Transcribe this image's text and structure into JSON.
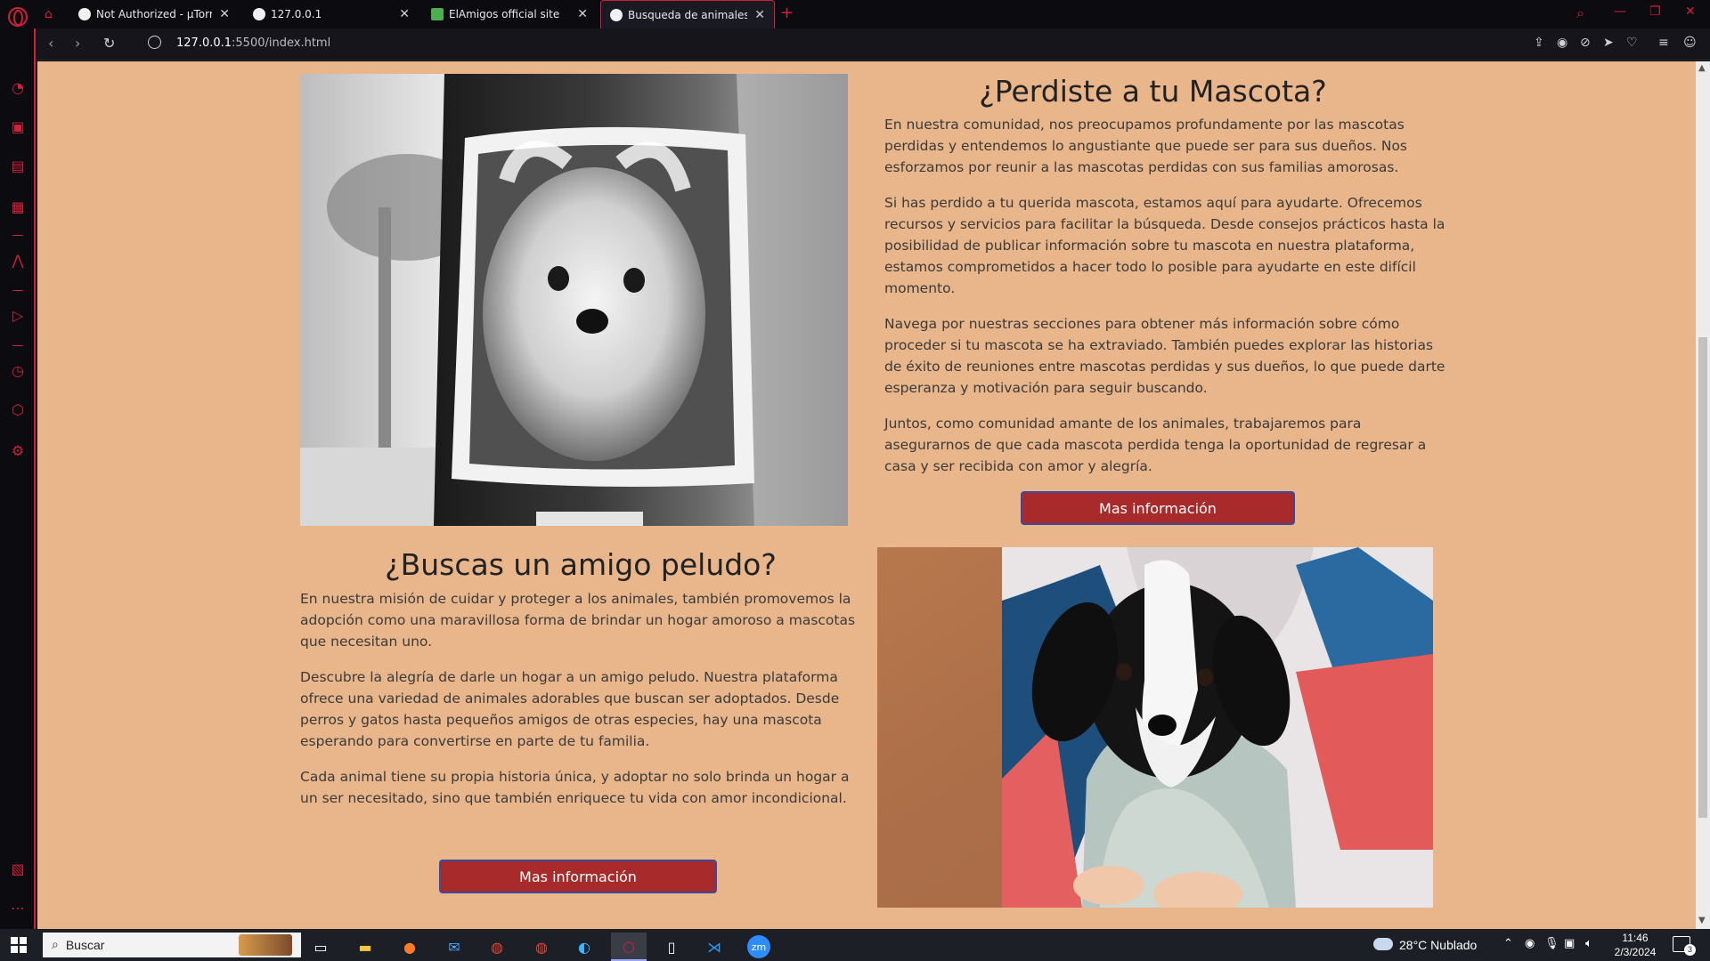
{
  "browser": {
    "tabs": [
      {
        "label": "Not Authorized - µTorrent W",
        "favicon": "globe-icon"
      },
      {
        "label": "127.0.0.1",
        "favicon": "globe-icon"
      },
      {
        "label": "ElAmigos official site",
        "favicon": "green-square-icon"
      },
      {
        "label": "Busqueda de animales perdi",
        "favicon": "globe-icon",
        "active": true
      }
    ],
    "url_host": "127.0.0.1",
    "url_path": ":5500/index.html",
    "accent_color": "#d0203a"
  },
  "page": {
    "background_color": "#e8b68a",
    "lost_pet": {
      "title": "¿Perdiste a tu Mascota?",
      "paragraphs": [
        "En nuestra comunidad, nos preocupamos profundamente por las mascotas perdidas y entendemos lo angustiante que puede ser para sus dueños. Nos esforzamos por reunir a las mascotas perdidas con sus familias amorosas.",
        "Si has perdido a tu querida mascota, estamos aquí para ayudarte. Ofrecemos recursos y servicios para facilitar la búsqueda. Desde consejos prácticos hasta la posibilidad de publicar información sobre tu mascota en nuestra plataforma, estamos comprometidos a hacer todo lo posible para ayudarte en este difícil momento.",
        "Navega por nuestras secciones para obtener más información sobre cómo proceder si tu mascota se ha extraviado. También puedes explorar las historias de éxito de reuniones entre mascotas perdidas y sus dueños, lo que puede darte esperanza y motivación para seguir buscando.",
        "Juntos, como comunidad amante de los animales, trabajaremos para asegurarnos de que cada mascota perdida tenga la oportunidad de regresar a casa y ser recibida con amor y alegría."
      ],
      "button_label": "Mas información"
    },
    "adopt": {
      "title": "¿Buscas un amigo peludo?",
      "paragraphs": [
        "En nuestra misión de cuidar y proteger a los animales, también promovemos la adopción como una maravillosa forma de brindar un hogar amoroso a mascotas que necesitan uno.",
        "Descubre la alegría de darle un hogar a un amigo peludo. Nuestra plataforma ofrece una variedad de animales adorables que buscan ser adoptados. Desde perros y gatos hasta pequeños amigos de otras especies, hay una mascota esperando para convertirse en parte de tu familia.",
        "Cada animal tiene su propia historia única, y adoptar no solo brinda un hogar a un ser necesitado, sino que también enriquece tu vida con amor incondicional."
      ],
      "button_label": "Mas información"
    },
    "button_color": "#a82a2a"
  },
  "taskbar": {
    "search_placeholder": "Buscar",
    "weather": "28°C  Nublado",
    "time": "11:46",
    "date": "2/3/2024",
    "notification_count": "3"
  }
}
